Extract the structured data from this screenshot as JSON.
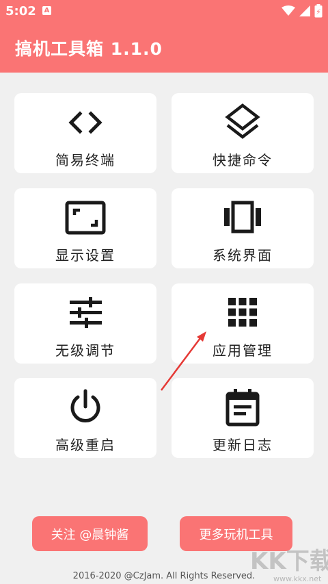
{
  "status_bar": {
    "time": "5:02",
    "notification_icon": "a-icon",
    "battery_glyph": "⚡"
  },
  "header": {
    "title": "搞机工具箱 1.1.0"
  },
  "menu": [
    {
      "label": "简易终端",
      "icon": "code-icon"
    },
    {
      "label": "快捷命令",
      "icon": "layers-icon"
    },
    {
      "label": "显示设置",
      "icon": "aspect-ratio-icon"
    },
    {
      "label": "系统界面",
      "icon": "view-carousel-icon"
    },
    {
      "label": "无级调节",
      "icon": "tune-icon"
    },
    {
      "label": "应用管理",
      "icon": "apps-grid-icon"
    },
    {
      "label": "高级重启",
      "icon": "power-icon"
    },
    {
      "label": "更新日志",
      "icon": "event-note-icon"
    }
  ],
  "buttons": {
    "follow": "关注 @晨钟酱",
    "more_tools": "更多玩机工具"
  },
  "footer": {
    "copyright": "2016-2020 @CzJam. All Rights Reserved."
  },
  "watermark": {
    "brand": "KK下载",
    "url": "www.kkx.net"
  },
  "colors": {
    "accent": "#fa7474",
    "background": "#f0f0f0",
    "card": "#ffffff",
    "icon": "#1a1a1a",
    "annotation_arrow": "#e53935"
  }
}
